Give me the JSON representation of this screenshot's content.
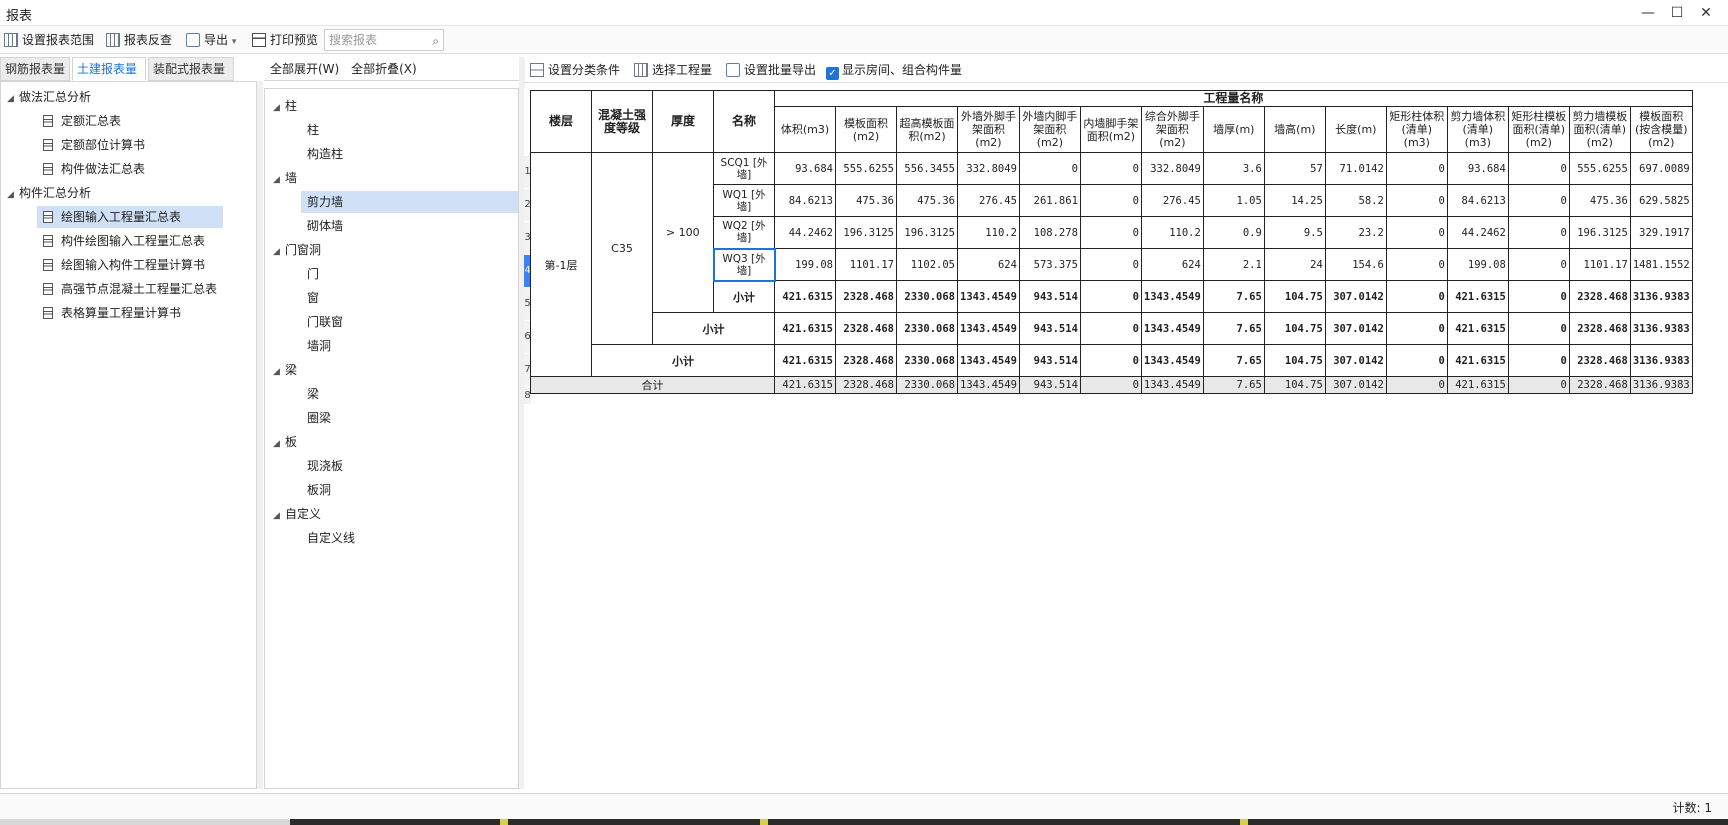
{
  "window": {
    "title": "报表",
    "controls": [
      "—",
      "☐",
      "✕"
    ]
  },
  "toolbar": {
    "set_range": "设置报表范围",
    "reverse": "报表反查",
    "export": "导出",
    "print_preview": "打印预览",
    "search_placeholder": "搜索报表"
  },
  "tabs": [
    "钢筋报表量",
    "土建报表量",
    "装配式报表量"
  ],
  "left_tree": {
    "group1": "做法汇总分析",
    "group1_items": [
      "定额汇总表",
      "定额部位计算书",
      "构件做法汇总表"
    ],
    "group2": "构件汇总分析",
    "group2_items": [
      "绘图输入工程量汇总表",
      "构件绘图输入工程量汇总表",
      "绘图输入构件工程量计算书",
      "高强节点混凝土工程量汇总表",
      "表格算量工程量计算书"
    ]
  },
  "mid": {
    "expand_all": "全部展开(W)",
    "collapse_all": "全部折叠(X)",
    "tree": [
      {
        "label": "柱",
        "children": [
          "柱",
          "构造柱"
        ]
      },
      {
        "label": "墙",
        "children": [
          "剪力墙",
          "砌体墙"
        ]
      },
      {
        "label": "门窗洞",
        "children": [
          "门",
          "窗",
          "门联窗",
          "墙洞"
        ]
      },
      {
        "label": "梁",
        "children": [
          "梁",
          "圈梁"
        ]
      },
      {
        "label": "板",
        "children": [
          "现浇板",
          "板洞"
        ]
      },
      {
        "label": "自定义",
        "children": [
          "自定义线"
        ]
      }
    ]
  },
  "right_toolbar": {
    "set_category": "设置分类条件",
    "select_quantity": "选择工程量",
    "batch_export": "设置批量导出",
    "show_rooms": "显示房间、组合构件量"
  },
  "table": {
    "group_header": "工程量名称",
    "fixed_headers": [
      "楼层",
      "混凝土强度等级",
      "厚度",
      "名称"
    ],
    "quantity_headers": [
      "体积(m3)",
      "模板面积(m2)",
      "超高模板面积(m2)",
      "外墙外脚手架面积(m2)",
      "外墙内脚手架面积(m2)",
      "内墙脚手架面积(m2)",
      "综合外脚手架面积(m2)",
      "墙厚(m)",
      "墙高(m)",
      "长度(m)",
      "矩形柱体积(清单)(m3)",
      "剪力墙体积(清单)(m3)",
      "矩形柱模板面积(清单)(m2)",
      "剪力墙模板面积(清单)(m2)",
      "模板面积(按含模量)(m2)"
    ],
    "floor": "第-1层",
    "grade": "C35",
    "thickness": "> 100",
    "rows": [
      {
        "name": "SCQ1 [外墙]",
        "values": [
          "93.684",
          "555.6255",
          "556.3455",
          "332.8049",
          "0",
          "0",
          "332.8049",
          "3.6",
          "57",
          "71.0142",
          "0",
          "93.684",
          "0",
          "555.6255",
          "697.0089"
        ]
      },
      {
        "name": "WQ1 [外墙]",
        "values": [
          "84.6213",
          "475.36",
          "475.36",
          "276.45",
          "261.861",
          "0",
          "276.45",
          "1.05",
          "14.25",
          "58.2",
          "0",
          "84.6213",
          "0",
          "475.36",
          "629.5825"
        ]
      },
      {
        "name": "WQ2 [外墙]",
        "values": [
          "44.2462",
          "196.3125",
          "196.3125",
          "110.2",
          "108.278",
          "0",
          "110.2",
          "0.9",
          "9.5",
          "23.2",
          "0",
          "44.2462",
          "0",
          "196.3125",
          "329.1917"
        ]
      },
      {
        "name": "WQ3 [外墙]",
        "values": [
          "199.08",
          "1101.17",
          "1102.05",
          "624",
          "573.375",
          "0",
          "624",
          "2.1",
          "24",
          "154.6",
          "0",
          "199.08",
          "0",
          "1101.17",
          "1481.1552"
        ]
      }
    ],
    "subtotal_label": "小计",
    "subtotal_values": [
      "421.6315",
      "2328.468",
      "2330.068",
      "1343.4549",
      "943.514",
      "0",
      "1343.4549",
      "7.65",
      "104.75",
      "307.0142",
      "0",
      "421.6315",
      "0",
      "2328.468",
      "3136.9383"
    ],
    "total_label": "合计",
    "total_values": [
      "421.6315",
      "2328.468",
      "2330.068",
      "1343.4549",
      "943.514",
      "0",
      "1343.4549",
      "7.65",
      "104.75",
      "307.0142",
      "0",
      "421.6315",
      "0",
      "2328.468",
      "3136.9383"
    ],
    "row_numbers": [
      "1",
      "2",
      "3",
      "4",
      "5",
      "6",
      "7",
      "8"
    ]
  },
  "status": {
    "count": "计数: 1"
  }
}
